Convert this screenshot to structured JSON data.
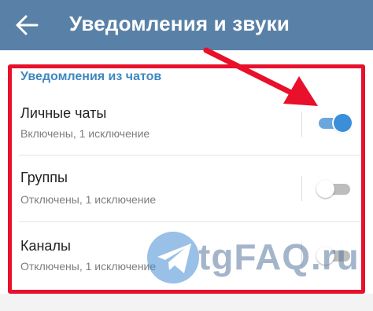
{
  "header": {
    "back_icon": "arrow-left-icon",
    "title": "Уведомления и звуки"
  },
  "section": {
    "title": "Уведомления из чатов"
  },
  "rows": [
    {
      "title": "Личные чаты",
      "subtitle": "Включены, 1 исключение",
      "enabled": true
    },
    {
      "title": "Группы",
      "subtitle": "Отключены, 1 исключение",
      "enabled": false
    },
    {
      "title": "Каналы",
      "subtitle": "Отключены, 1 исключение",
      "enabled": false
    }
  ],
  "watermark": {
    "text": "tgFAQ.ru",
    "icon": "telegram-logo-icon"
  },
  "colors": {
    "app_bar": "#5981a7",
    "accent": "#3f87c1",
    "toggle_on": "#3b8ed9",
    "annotation": "#e8102a"
  }
}
